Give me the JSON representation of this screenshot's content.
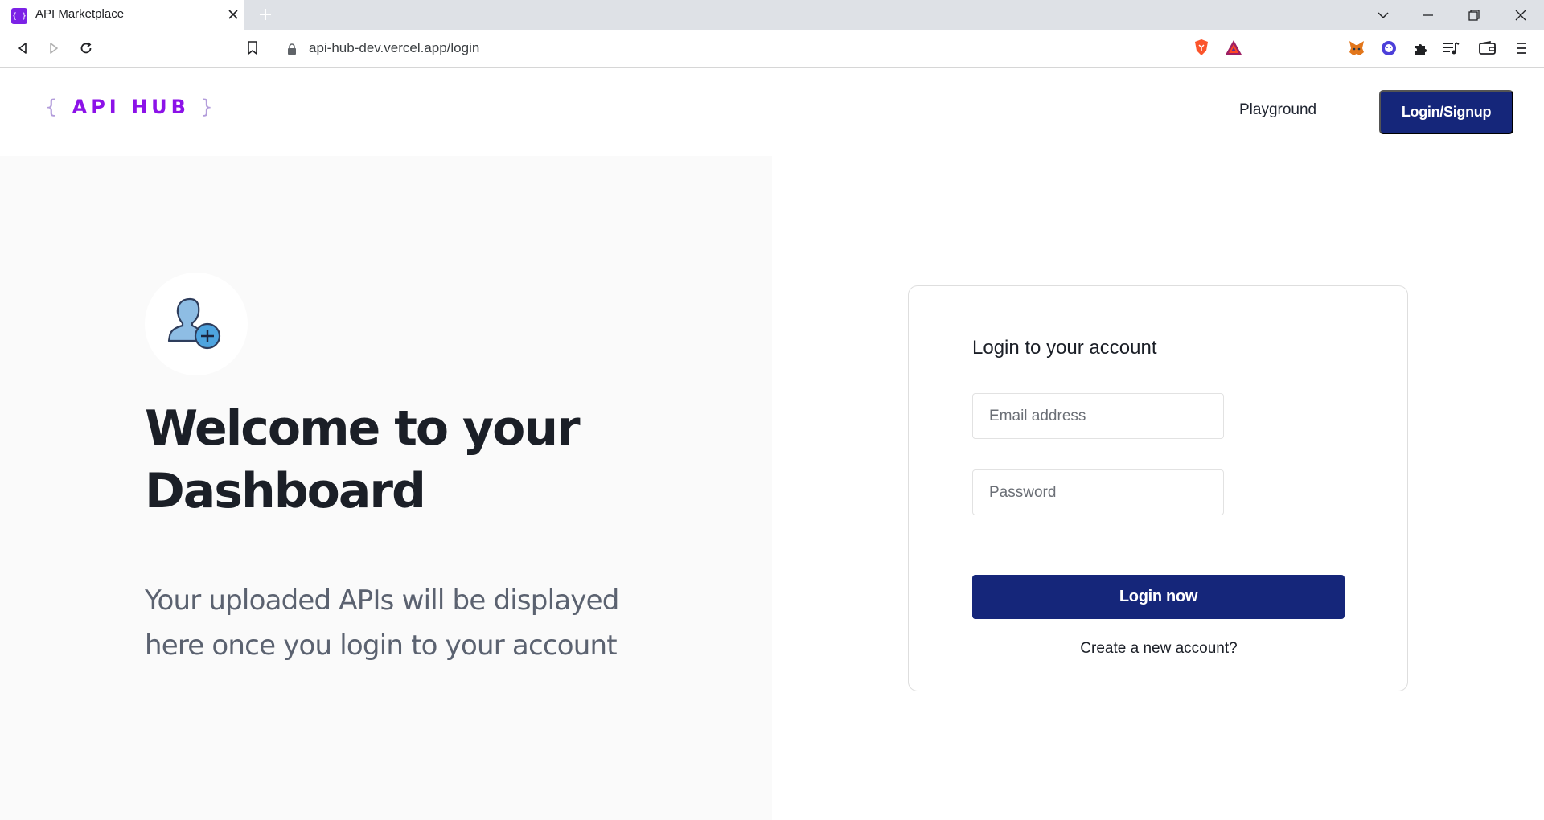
{
  "browser": {
    "tab_title": "API Marketplace",
    "tab_favicon_text": "{ }",
    "url": "api-hub-dev.vercel.app/login"
  },
  "header": {
    "logo_open": "{",
    "logo_text": "API HUB",
    "logo_close": "}",
    "nav_playground": "Playground",
    "login_signup_label": "Login/Signup"
  },
  "hero": {
    "title": "Welcome to your Dashboard",
    "subtitle": "Your uploaded APIs will be displayed here once you login to your account"
  },
  "login_form": {
    "title": "Login to your account",
    "email_placeholder": "Email address",
    "password_placeholder": "Password",
    "submit_label": "Login now",
    "create_account_link": "Create a new account?"
  },
  "colors": {
    "primary_button": "#15267a",
    "logo": "#8c12e8",
    "left_panel_bg": "#fafafa"
  },
  "icons": [
    "back-icon",
    "forward-icon",
    "reload-icon",
    "bookmark-icon",
    "lock-icon",
    "brave-shield-icon",
    "brave-rewards-icon",
    "metamask-icon",
    "extension-icon",
    "puzzle-icon",
    "media-icon",
    "wallet-icon",
    "menu-icon",
    "add-user-icon"
  ]
}
